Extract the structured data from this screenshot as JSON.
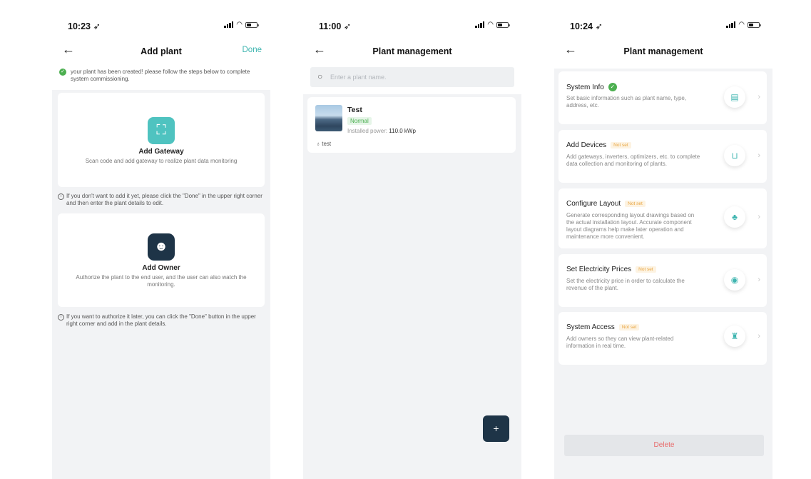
{
  "status_bars": [
    {
      "time": "10:23 ➶"
    },
    {
      "time": "11:00 ➶"
    },
    {
      "time": "10:24 ➶"
    }
  ],
  "screen1": {
    "title": "Add plant",
    "done_label": "Done",
    "notice": "your plant has been created! please follow the steps below to complete system commissioning.",
    "gateway": {
      "title": "Add Gateway",
      "desc": "Scan code and add gateway to realize plant data monitoring"
    },
    "hint1": "If you don't want to add it yet, please click the \"Done\" in the upper right corner and then enter the plant details to edit.",
    "owner": {
      "title": "Add Owner",
      "desc": "Authorize the plant to the end user, and the user can also watch the monitoring."
    },
    "hint2": "If you want to authorize it later, you can click the \"Done\" button in the upper right corner and add in the plant details."
  },
  "screen2": {
    "title": "Plant management",
    "search_placeholder": "Enter a plant name.",
    "plant": {
      "name": "Test",
      "status": "Normal",
      "power_label": "Installed power: ",
      "power_value": "110.0 kWp",
      "owner": "test"
    },
    "fab_label": "+"
  },
  "screen3": {
    "title": "Plant management",
    "items": [
      {
        "title": "System Info",
        "badge": "",
        "desc": "Set basic information such as plant name, type, address, etc."
      },
      {
        "title": "Add Devices",
        "badge": "Not set",
        "desc": "Add gateways, inverters, optimizers, etc. to complete data collection and monitoring of plants."
      },
      {
        "title": "Configure Layout",
        "badge": "Not set",
        "desc": "Generate corresponding layout drawings based on the actual installation layout. Accurate component layout diagrams help make later operation and maintenance more convenient."
      },
      {
        "title": "Set Electricity Prices",
        "badge": "Not set",
        "desc": "Set the electricity price in order to calculate the revenue of the plant."
      },
      {
        "title": "System Access",
        "badge": "Not set",
        "desc": "Add owners so they can view plant-related information in real time."
      }
    ],
    "delete_label": "Delete"
  },
  "colors": {
    "accent": "#3fb5b0",
    "success": "#4caf50",
    "warning": "#e8a33d",
    "danger": "#e86b6b",
    "fab": "#1e3447"
  }
}
